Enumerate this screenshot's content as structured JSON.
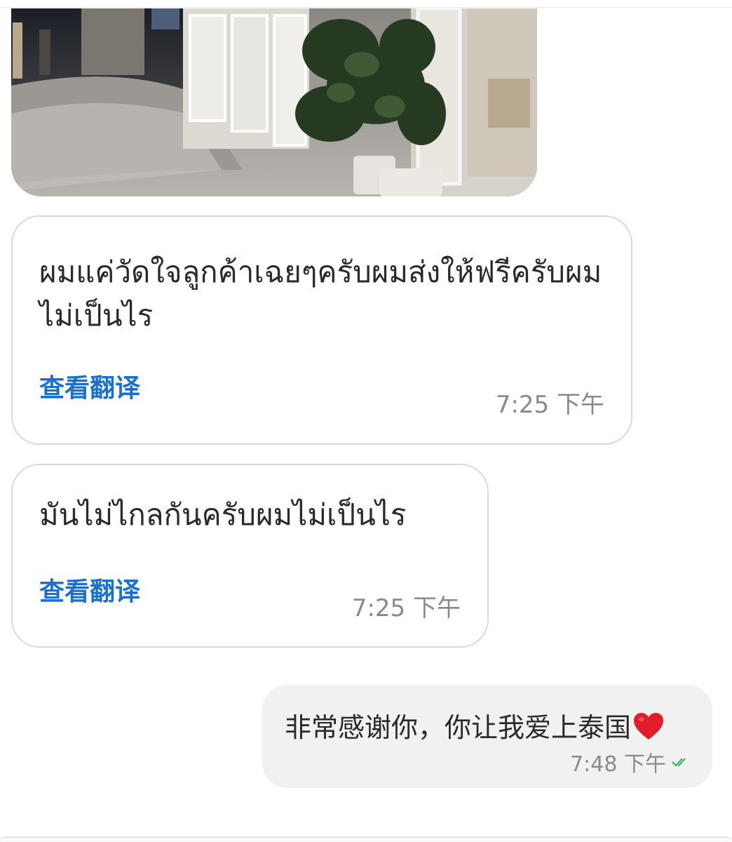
{
  "messages": [
    {
      "text": "ผมแค่วัดใจลูกค้าเฉยๆครับผมส่งให้ฟรีครับผมไม่เป็นไร",
      "translate_label": "查看翻译",
      "time": "7:25 下午"
    },
    {
      "text": "มันไม่ไกลกันครับผมไม่เป็นไร",
      "translate_label": "查看翻译",
      "time": "7:25 下午"
    }
  ],
  "outgoing": {
    "text": "非常感谢你，你让我爱上泰国",
    "emoji": "heart-icon",
    "time": "7:48 下午",
    "status": "read"
  },
  "colors": {
    "link": "#1a6fd1",
    "time": "#8a8a8a",
    "outgoing_bg": "#f1f1f1",
    "read_check": "#2fb24c",
    "heart": "#e01e2b"
  }
}
